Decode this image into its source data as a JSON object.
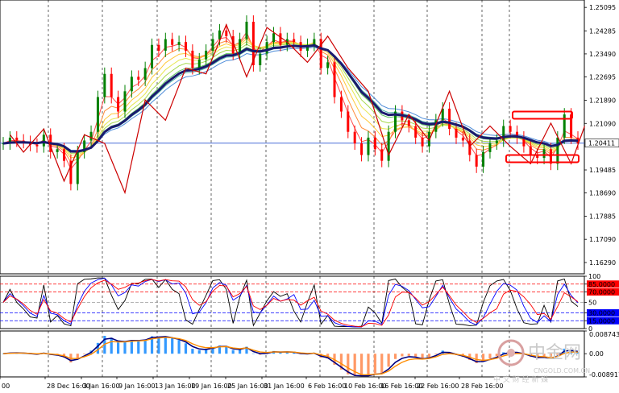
{
  "chart_data": [
    {
      "type": "candlestick",
      "panel": "price",
      "y_ticks": [
        "1.25095",
        "1.24285",
        "1.23490",
        "1.22695",
        "1.21890",
        "1.21090",
        "1.20411",
        "1.19485",
        "1.18690",
        "1.17885",
        "1.17090",
        "1.16290"
      ],
      "ylim": [
        1.159,
        1.2535
      ],
      "current_price": "1.20411",
      "current_price_value": 1.20411,
      "close_series": [
        1.204,
        1.206,
        1.205,
        1.2045,
        1.2035,
        1.203,
        1.207,
        1.201,
        1.202,
        1.198,
        1.19,
        1.201,
        1.205,
        1.208,
        1.22,
        1.228,
        1.22,
        1.215,
        1.222,
        1.227,
        1.226,
        1.23,
        1.238,
        1.236,
        1.24,
        1.238,
        1.239,
        1.236,
        1.23,
        1.233,
        1.236,
        1.24,
        1.243,
        1.241,
        1.235,
        1.24,
        1.246,
        1.231,
        1.235,
        1.239,
        1.242,
        1.238,
        1.24,
        1.239,
        1.236,
        1.238,
        1.24,
        1.23,
        1.232,
        1.22,
        1.215,
        1.208,
        1.204,
        1.2,
        1.206,
        1.202,
        1.198,
        1.208,
        1.215,
        1.212,
        1.21,
        1.206,
        1.203,
        1.208,
        1.212,
        1.216,
        1.209,
        1.206,
        1.205,
        1.2,
        1.196,
        1.201,
        1.204,
        1.205,
        1.21,
        1.208,
        1.206,
        1.203,
        1.2,
        1.199,
        1.202,
        1.197,
        1.206,
        1.214,
        1.206,
        1.204
      ],
      "swing_line": [
        [
          1,
          1.207
        ],
        [
          3,
          1.201
        ],
        [
          6,
          1.209
        ],
        [
          9,
          1.191
        ],
        [
          12,
          1.207
        ],
        [
          15,
          1.204
        ],
        [
          18,
          1.187
        ],
        [
          21,
          1.219
        ],
        [
          24,
          1.212
        ],
        [
          27,
          1.23
        ],
        [
          30,
          1.228
        ],
        [
          33,
          1.245
        ],
        [
          36,
          1.227
        ],
        [
          39,
          1.244
        ],
        [
          42,
          1.239
        ],
        [
          45,
          1.232
        ],
        [
          48,
          1.241
        ],
        [
          51,
          1.23
        ],
        [
          54,
          1.222
        ],
        [
          57,
          1.2
        ],
        [
          60,
          1.214
        ],
        [
          63,
          1.205
        ],
        [
          66,
          1.222
        ],
        [
          69,
          1.203
        ],
        [
          72,
          1.21
        ],
        [
          75,
          1.203
        ],
        [
          78,
          1.197
        ],
        [
          81,
          1.211
        ],
        [
          84,
          1.197
        ],
        [
          86,
          1.21
        ]
      ],
      "boxes": [
        {
          "name": "resistance-box",
          "y_top": 1.215,
          "y_bottom": 1.2125
        },
        {
          "name": "support-box",
          "y_top": 1.2,
          "y_bottom": 1.1975
        }
      ]
    },
    {
      "type": "line",
      "panel": "oscillator",
      "y_ticks": [
        "100",
        "85.0000",
        "70.0000",
        "50",
        "30.0000",
        "15.0000",
        "0"
      ],
      "ylim": [
        0,
        100
      ],
      "levels": [
        {
          "value": 85,
          "label": "85.0000",
          "color": "#ff0000"
        },
        {
          "value": 70,
          "label": "70.0000",
          "color": "#ff0000"
        },
        {
          "value": 50,
          "label": "",
          "color": "#999999"
        },
        {
          "value": 30,
          "label": "30.0000",
          "color": "#0000ff"
        },
        {
          "value": 15,
          "label": "15.0000",
          "color": "#0000ff"
        }
      ]
    },
    {
      "type": "bar",
      "panel": "macd",
      "y_ticks": [
        "0.0087434",
        "0.00",
        "-0.0089178"
      ],
      "ylim": [
        -0.0089178,
        0.0087434
      ]
    }
  ],
  "x_ticks": [
    "00",
    "28 Dec 16:00",
    "3 Jan 16:00",
    "9 Jan 16:00",
    "13 Jan 16:00",
    "19 Jan 16:00",
    "25 Jan 16:00",
    "31 Jan 16:00",
    "6 Feb 16:00",
    "10 Feb 16:00",
    "16 Feb 16:00",
    "22 Feb 16:00",
    "28 Feb 16:00"
  ],
  "watermark": {
    "brand": "中金网",
    "url": "CNGOLD.COM.CN",
    "tagline": "中 文 财 经 新 媒"
  },
  "colors": {
    "bull": "#008000",
    "bear": "#ff0000",
    "ema_slow": "#1a1a6e",
    "swing": "#cc0000",
    "price_line": "#4a6fd8",
    "macd_pos": "#3399ff",
    "macd_neg": "#ff9966",
    "macd_line": "#000080",
    "signal_line": "#ff8c00",
    "osc_line_1": "#000000",
    "osc_line_2": "#0000ff",
    "osc_line_3": "#ff0000"
  }
}
